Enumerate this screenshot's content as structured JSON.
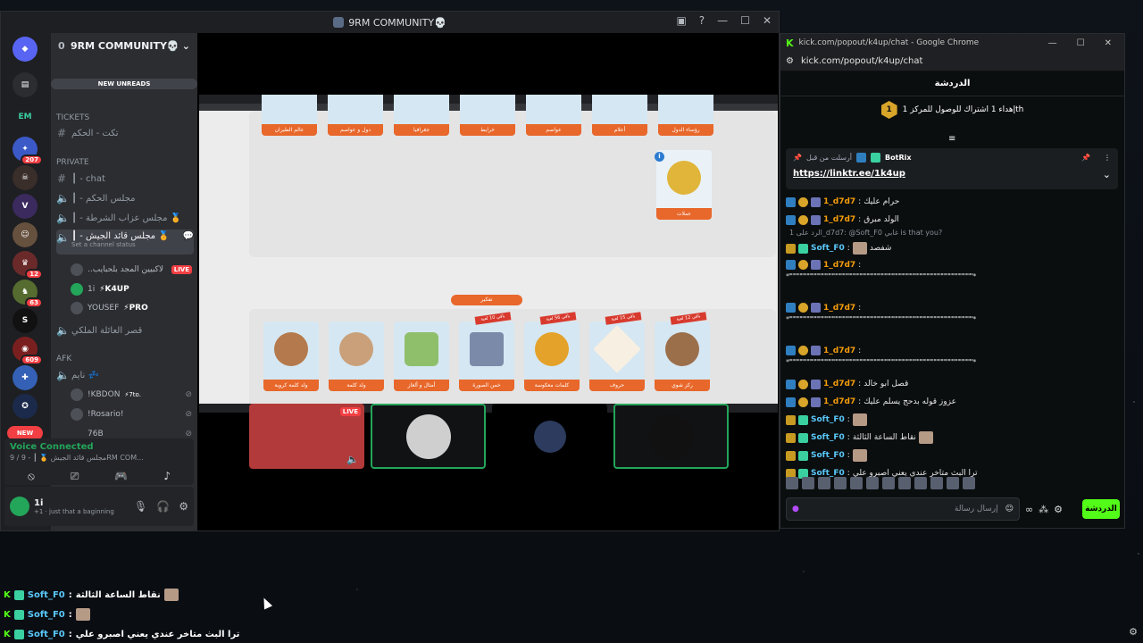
{
  "discord": {
    "title": "9RM COMMUNITY💀",
    "server_badges": [
      "207",
      "12",
      "63",
      "609"
    ],
    "new_label": "NEW",
    "guild_name": "9RM COMMUNITY💀",
    "guild_count": "0",
    "new_unreads": "NEW UNREADS",
    "categories": {
      "tickets": "TICKETS",
      "private": "Private",
      "afk": "AFK"
    },
    "channels": {
      "tickets_1": "تكت - الحكم",
      "chat": "┃ - chat",
      "judge": "┃ - مجلس الحكم",
      "police": "┃ - مجلس عزاب الشرطة 🏅",
      "army": "┃ - مجلس قائد الجيش 🏅",
      "set_status": "Set a channel status",
      "royal": "قصر العائلة الملكي",
      "afk_ch": "نايم 💤"
    },
    "voice_users": [
      {
        "name": "..لاكبيين المجد بلحبايب",
        "tag": "LIVE"
      },
      {
        "name": "1i",
        "tag": "⚡K4UP"
      },
      {
        "name": "YOUSEF",
        "tag": "⚡PRO"
      }
    ],
    "afk_users": [
      {
        "name": "!KBDON",
        "tag": "⚡7to."
      },
      {
        "name": "!Rosario!",
        "tag": ""
      },
      {
        "name": "76B",
        "tag": ""
      }
    ],
    "voice_connected": "Voice Connected",
    "voice_channel": "9 / مجلس قائد الجيش 🏅 ┃ - 9RM COM...",
    "user_name": "1i",
    "user_status": "+1 · just that a baginning",
    "stage_tiles": {
      "live_label": "LIVE"
    }
  },
  "screen_share": {
    "top_labels": [
      "عالم الطيران",
      "دول و عواصم",
      "جغرافيا",
      "خرايط",
      "عواصم",
      "أعلام",
      "رؤساء الدول"
    ],
    "coins_label": "عملات",
    "section_label": "تفكير",
    "bottom_labels": [
      "ولد كلمة كروية",
      "ولد كلمة",
      "أمثال و ألغاز",
      "خمن الصورة",
      "كلمات معكوسة",
      "حروف",
      "ركز شوي"
    ],
    "ribbons": [
      "باقي 12 لعبة",
      "باقي 15 لعبة",
      "باقي 56 لعبة",
      "باقي 10 لعبة"
    ]
  },
  "chrome": {
    "window_title": "kick.com/popout/k4up/chat - Google Chrome",
    "url": "kick.com/popout/k4up/chat",
    "chat_title": "الدردشة",
    "sub_goal": "إهداء 1 اشتراك للوصول للمركز 1th",
    "sub_goal_badge": "1",
    "pinned_by": "أرسلت من قبل",
    "pinned_user": "BotRix",
    "pinned_link": "https://linktr.ee/1k4up",
    "messages": [
      {
        "user": "1_d7d7",
        "color": "o",
        "text": "حرام عليك"
      },
      {
        "user": "1_d7d7",
        "color": "o",
        "text": "الولد مبرق"
      },
      {
        "reply": "الرد على 1_d7d7: @Soft_F0 غابي is that you?"
      },
      {
        "user": "Soft_F0",
        "color": "g",
        "text": "شفصد",
        "emote": true
      },
      {
        "user": "1_d7d7",
        "color": "o",
        "text": "",
        "dashes": "*\"\"\"\"\"\"\"\"\"\"\"\"\"\"\"\"\"\"\"\"\"\"\"\"\"\"\"\"\"\"\"\"\"\"\"\"\"\"\"\"\"\"\"\"\"\"\"\"\"\"\"\"\"\"\"\"\"\"\"\"\"\"\"\"\"\"\"\"\"\"\"\"\"\"\"\"\"*"
      },
      {
        "user": "1_d7d7",
        "color": "o",
        "text": "",
        "dashes": "*\"\"\"\"\"\"\"\"\"\"\"\"\"\"\"\"\"\"\"\"\"\"\"\"\"\"\"\"\"\"\"\"\"\"\"\"\"\"\"\"\"\"\"\"\"\"\"\"\"\"\"\"\"\"\"\"\"\"\"\"\"\"\"\"\"\"\"\"\"\"\"\"\"\"\"\"\"*"
      },
      {
        "user": "1_d7d7",
        "color": "o",
        "text": "",
        "dashes": "*\"\"\"\"\"\"\"\"\"\"\"\"\"\"\"\"\"\"\"\"\"\"\"\"\"\"\"\"\"\"\"\"\"\"\"\"\"\"\"\"\"\"\"\"\"\"\"\"\"\"\"\"\"\"\"\"\"\"\"\"\"\"\"\"\"\"\"\"\"\"\"\"\"\"\"\"\"*"
      },
      {
        "user": "1_d7d7",
        "color": "o",
        "text": "قصل ابو خالد"
      },
      {
        "user": "1_d7d7",
        "color": "o",
        "text": "عزوز قوله بدحج يسلم عليك"
      },
      {
        "user": "Soft_F0",
        "color": "g",
        "text": "",
        "emote": true
      },
      {
        "user": "Soft_F0",
        "color": "g",
        "text": "نقاط الساعة الثالثة",
        "emote": true
      },
      {
        "user": "Soft_F0",
        "color": "g",
        "text": "",
        "emote": true
      },
      {
        "user": "Soft_F0",
        "color": "g",
        "text": "ترا البث متاخر عندي يعني اصبرو علي"
      }
    ],
    "input_placeholder": "إرسال رسالة",
    "send_label": "الدردشة"
  },
  "overlay": [
    {
      "user": "Soft_F0",
      "text": "نقاط الساعة الثالثة"
    },
    {
      "user": "Soft_F0",
      "text": ""
    },
    {
      "user": "Soft_F0",
      "text": "ترا البث متاخر عندي يعني اصبرو علي"
    }
  ]
}
